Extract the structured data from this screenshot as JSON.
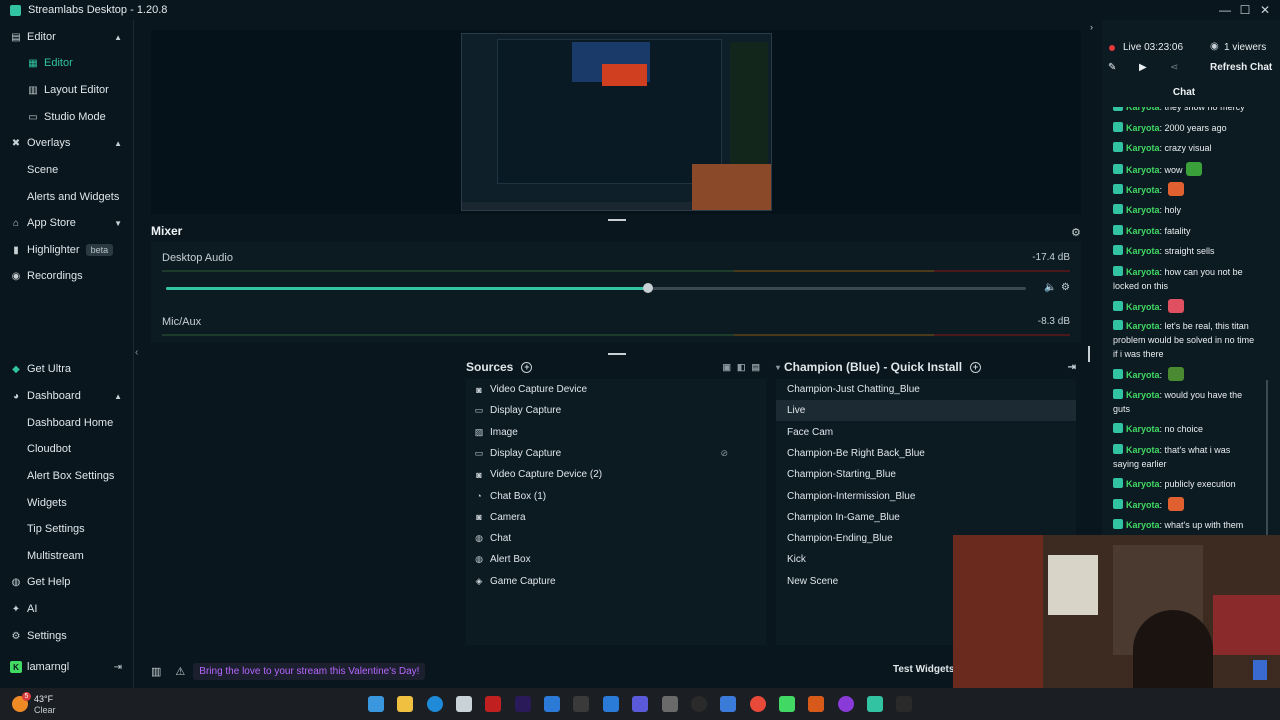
{
  "window": {
    "title": "Streamlabs Desktop - 1.20.8",
    "min": "—",
    "max": "☐",
    "close": "✕"
  },
  "nav": {
    "editor": "Editor",
    "editor_sub": [
      "Editor",
      "Layout Editor",
      "Studio Mode"
    ],
    "overlays": "Overlays",
    "overlays_sub": [
      "Scene",
      "Alerts and Widgets"
    ],
    "app_store": "App Store",
    "highlighter": "Highlighter",
    "highlighter_badge": "beta",
    "recordings": "Recordings",
    "get_ultra": "Get Ultra",
    "dashboard": "Dashboard",
    "dashboard_sub": [
      "Dashboard Home",
      "Cloudbot",
      "Alert Box Settings",
      "Widgets",
      "Tip Settings",
      "Multistream"
    ],
    "get_help": "Get Help",
    "ai": "AI",
    "settings": "Settings",
    "user": "lamarngl"
  },
  "mixer": {
    "title": "Mixer",
    "channels": [
      {
        "name": "Desktop Audio",
        "db": "-17.4 dB",
        "volume": 0.56
      },
      {
        "name": "Mic/Aux",
        "db": "-8.3 dB"
      }
    ]
  },
  "sources": {
    "title": "Sources",
    "items": [
      {
        "label": "Video Capture Device",
        "icon": "camera-icon"
      },
      {
        "label": "Display Capture",
        "icon": "monitor-icon"
      },
      {
        "label": "Image",
        "icon": "image-icon"
      },
      {
        "label": "Display Capture",
        "icon": "monitor-icon"
      },
      {
        "label": "Video Capture Device (2)",
        "icon": "camera-icon"
      },
      {
        "label": "Chat Box (1)",
        "icon": "chat-icon"
      },
      {
        "label": "Camera",
        "icon": "camera-icon"
      },
      {
        "label": "Chat",
        "icon": "globe-icon"
      },
      {
        "label": "Alert Box",
        "icon": "globe-icon"
      },
      {
        "label": "Game Capture",
        "icon": "gamepad-icon"
      }
    ]
  },
  "scenes": {
    "title": "Champion (Blue) - Quick Install",
    "items": [
      "Champion-Just Chatting_Blue",
      "Live",
      "Face Cam",
      "Champion-Be Right Back_Blue",
      "Champion-Starting_Blue",
      "Champion-Intermission_Blue",
      "Champion In-Game_Blue",
      "Champion-Ending_Blue",
      "Kick",
      "New Scene"
    ],
    "selected": "Live"
  },
  "bottom": {
    "banner": "Bring the love to your stream this Valentine's Day!",
    "test_widgets": "Test Widgets"
  },
  "live": {
    "status": "Live 03:23:06",
    "viewers": "1 viewers",
    "refresh": "Refresh Chat"
  },
  "chat": {
    "title": "Chat",
    "messages": [
      {
        "nick": "Karyota",
        "text": "they show no mercy"
      },
      {
        "nick": "Karyota",
        "text": "2000 years ago"
      },
      {
        "nick": "Karyota",
        "text": "crazy visual"
      },
      {
        "nick": "Karyota",
        "text": "wow"
      },
      {
        "nick": "Karyota",
        "text": ""
      },
      {
        "nick": "Karyota",
        "text": "holy"
      },
      {
        "nick": "Karyota",
        "text": "fatality"
      },
      {
        "nick": "Karyota",
        "text": "straight sells"
      },
      {
        "nick": "Karyota",
        "text": "how can you not be locked on this"
      },
      {
        "nick": "Karyota",
        "text": ""
      },
      {
        "nick": "Karyota",
        "text": "let's be real, this titan problem would be solved in no time if i was there"
      },
      {
        "nick": "Karyota",
        "text": ""
      },
      {
        "nick": "Karyota",
        "text": "would you have the guts"
      },
      {
        "nick": "Karyota",
        "text": "no choice"
      },
      {
        "nick": "Karyota",
        "text": "that's what i was saying earlier"
      },
      {
        "nick": "Karyota",
        "text": "publicly execution"
      },
      {
        "nick": "Karyota",
        "text": ""
      },
      {
        "nick": "Karyota",
        "text": "what's up with them"
      }
    ]
  },
  "weather": {
    "temp": "43°F",
    "condition": "Clear",
    "alert_count": "5"
  }
}
